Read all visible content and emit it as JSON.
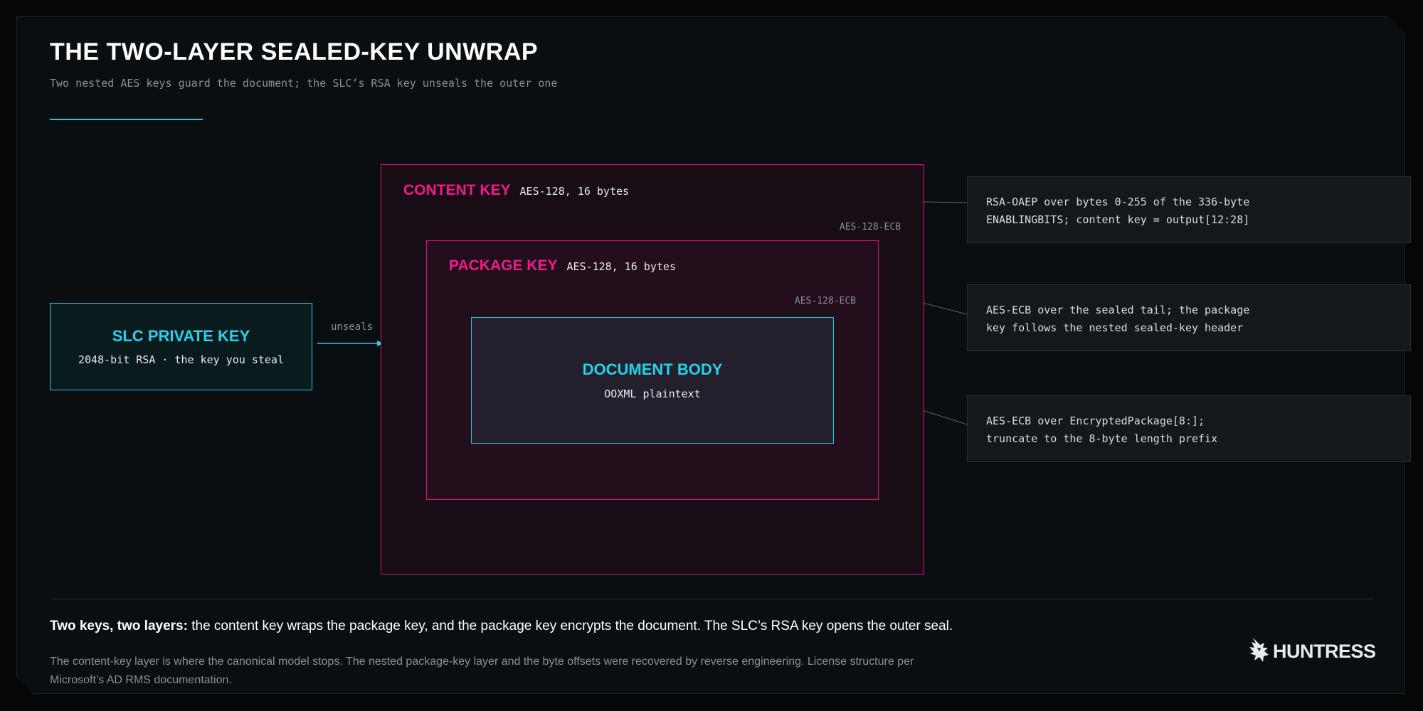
{
  "header": {
    "title": "THE TWO-LAYER SEALED-KEY UNWRAP",
    "subtitle": "Two nested AES keys guard the document; the SLC’s RSA key unseals the outer one"
  },
  "diagram": {
    "slc": {
      "title": "SLC PRIVATE KEY",
      "detail": "2048-bit RSA · the key you steal"
    },
    "arrow_label": "unseals",
    "content_key": {
      "title": "CONTENT KEY",
      "detail": "AES-128, 16 bytes",
      "cipher": "AES-128-ECB"
    },
    "package_key": {
      "title": "PACKAGE KEY",
      "detail": "AES-128, 16 bytes",
      "cipher": "AES-128-ECB"
    },
    "document": {
      "title": "DOCUMENT BODY",
      "detail": "OOXML plaintext"
    }
  },
  "notes": [
    {
      "line1": "RSA-OAEP over bytes 0-255 of the 336-byte",
      "line2": "ENABLINGBITS; content key = output[12:28]"
    },
    {
      "line1": "AES-ECB over the sealed tail; the package",
      "line2": "key follows the nested sealed-key header"
    },
    {
      "line1": "AES-ECB over EncryptedPackage[8:];",
      "line2": "truncate to the 8-byte length prefix"
    }
  ],
  "footer": {
    "summary_bold": "Two keys, two layers:",
    "summary_rest": " the content key wraps the package key, and the package key encrypts the document. The SLC’s RSA key opens the outer seal.",
    "footnote": "The content-key layer is where the canonical model stops. The nested package-key layer and the byte offsets were recovered by reverse engineering. License structure per Microsoft’s AD RMS documentation.",
    "logo_text": "HUNTRESS",
    "logo_icon": "huntress-eagle-icon"
  },
  "colors": {
    "background": "#0b0e10",
    "magenta": "#ef1c8a",
    "cyan": "#22d3ea",
    "text": "#ffffff",
    "muted": "#8a9096"
  }
}
